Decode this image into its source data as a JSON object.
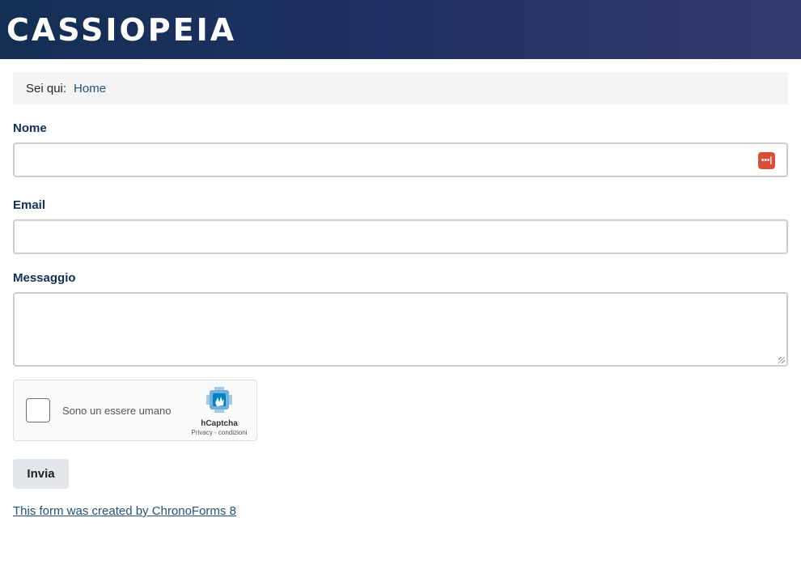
{
  "header": {
    "brand": "CASSIOPEIA"
  },
  "breadcrumb": {
    "label": "Sei qui:",
    "home": "Home"
  },
  "form": {
    "fields": [
      {
        "label": "Nome",
        "value": ""
      },
      {
        "label": "Email",
        "value": ""
      },
      {
        "label": "Messaggio",
        "value": ""
      }
    ],
    "captcha": {
      "checkbox_label": "Sono un essere umano",
      "brand": "hCaptcha",
      "links": "Privacy - condizioni"
    },
    "submit_label": "Invia"
  },
  "footer": {
    "credit": "This form was created by ChronoForms 8"
  },
  "colors": {
    "header_start": "#132f53",
    "header_end": "#35396f",
    "link": "#224f7a",
    "password_icon": "#d94f36"
  },
  "icons": {
    "password_manager": "password-manager-icon",
    "captcha_logo": "hcaptcha-logo-icon"
  }
}
